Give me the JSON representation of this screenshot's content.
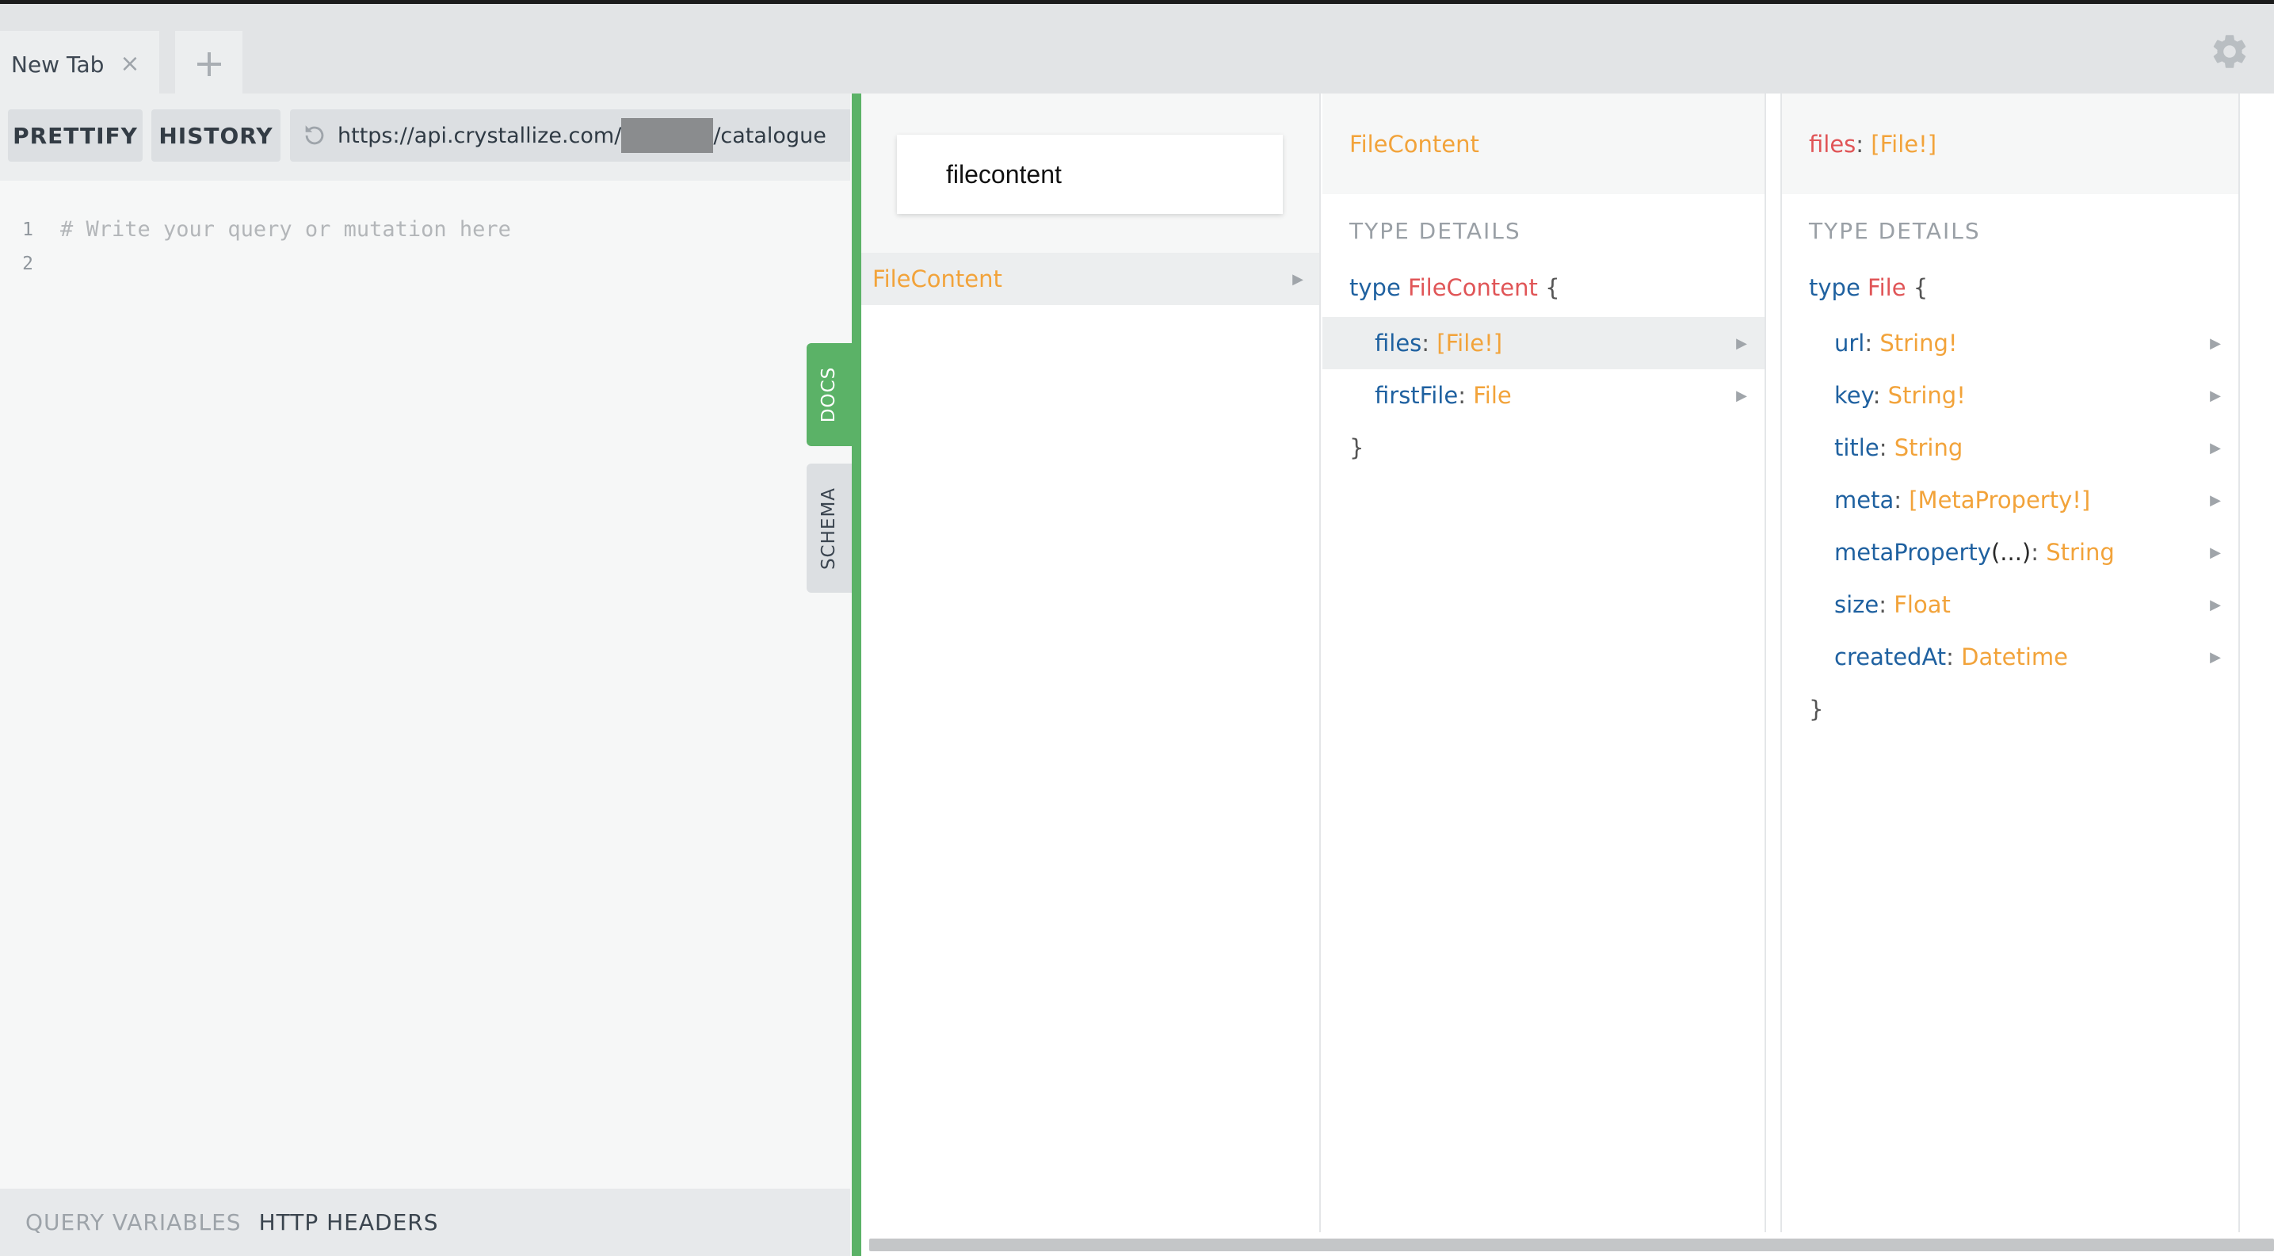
{
  "tabs": [
    {
      "label": "New Tab",
      "close": "×"
    }
  ],
  "new_tab_symbol": "+",
  "toolbar": {
    "prettify_label": "PRETTIFY",
    "history_label": "HISTORY",
    "url_prefix": "https://api.crystallize.com/",
    "url_suffix": "/catalogue"
  },
  "editor": {
    "lines": [
      {
        "number": "1",
        "text": "# Write your query or mutation here"
      },
      {
        "number": "2",
        "text": ""
      }
    ]
  },
  "bottom_tabs": {
    "query_variables": "QUERY VARIABLES",
    "http_headers": "HTTP HEADERS"
  },
  "side_tabs": {
    "docs": "DOCS",
    "schema": "SCHEMA"
  },
  "docs": {
    "search_value": "filecontent",
    "search_results": [
      {
        "label": "FileContent",
        "arrow": "▶"
      }
    ],
    "column2": {
      "header": "FileContent",
      "section": "TYPE DETAILS",
      "keyword": "type",
      "type_name": "FileContent",
      "open_brace": "{",
      "close_brace": "}",
      "fields": [
        {
          "name": "files",
          "colon": ":",
          "type": "[File!]",
          "arrow": "▶",
          "active": true
        },
        {
          "name": "firstFile",
          "colon": ":",
          "type": "File",
          "arrow": "▶",
          "active": false
        }
      ]
    },
    "column3": {
      "header_field": "files",
      "header_colon": ":",
      "header_type": "[File!]",
      "section": "TYPE DETAILS",
      "keyword": "type",
      "type_name": "File",
      "open_brace": "{",
      "close_brace": "}",
      "fields": [
        {
          "name": "url",
          "args": "",
          "colon": ":",
          "type": "String!",
          "arrow": "▶"
        },
        {
          "name": "key",
          "args": "",
          "colon": ":",
          "type": "String!",
          "arrow": "▶"
        },
        {
          "name": "title",
          "args": "",
          "colon": ":",
          "type": "String",
          "arrow": "▶"
        },
        {
          "name": "meta",
          "args": "",
          "colon": ":",
          "type": "[MetaProperty!]",
          "arrow": "▶"
        },
        {
          "name": "metaProperty",
          "args": "(...)",
          "colon": ":",
          "type": "String",
          "arrow": "▶"
        },
        {
          "name": "size",
          "args": "",
          "colon": ":",
          "type": "Float",
          "arrow": "▶"
        },
        {
          "name": "createdAt",
          "args": "",
          "colon": ":",
          "type": "Datetime",
          "arrow": "▶"
        }
      ]
    }
  },
  "colors": {
    "accent_green": "#5bb267",
    "type_orange": "#f2a33a",
    "type_red": "#e05557",
    "field_blue": "#1f61a0"
  }
}
